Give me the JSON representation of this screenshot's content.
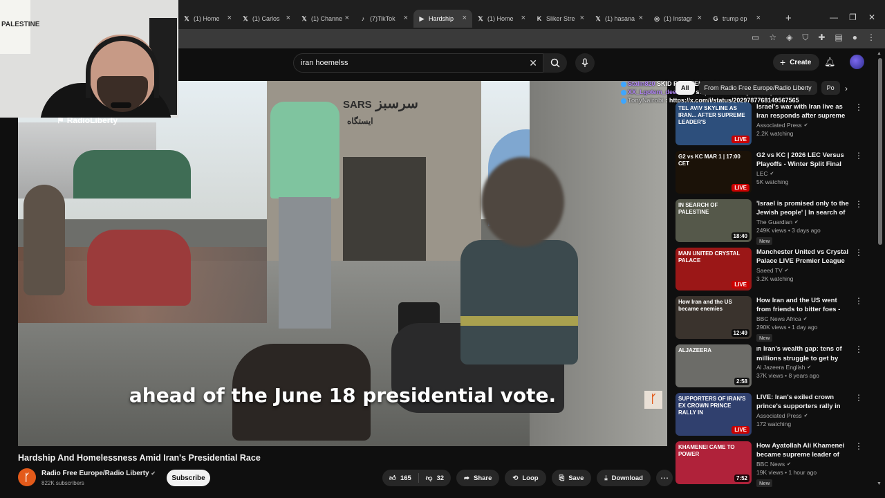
{
  "browser": {
    "tabs": [
      {
        "label": "(1) Home",
        "icon": "x-logo-icon",
        "glyph": "𝕏",
        "active": false
      },
      {
        "label": "(1) Carlos",
        "icon": "x-logo-icon",
        "glyph": "𝕏",
        "active": false
      },
      {
        "label": "(1) Channe",
        "icon": "x-logo-icon",
        "glyph": "𝕏",
        "active": false
      },
      {
        "label": "(7)TikTok",
        "icon": "tiktok-icon",
        "glyph": "♪",
        "active": false
      },
      {
        "label": "Hardship",
        "icon": "youtube-icon",
        "glyph": "▶",
        "active": true
      },
      {
        "label": "(1) Home",
        "icon": "x-logo-icon",
        "glyph": "𝕏",
        "active": false
      },
      {
        "label": "Sliker Stre",
        "icon": "kick-icon",
        "glyph": "K",
        "active": false
      },
      {
        "label": "(1) hasana",
        "icon": "x-logo-icon",
        "glyph": "𝕏",
        "active": false
      },
      {
        "label": "(1) Instagr",
        "icon": "instagram-icon",
        "glyph": "◎",
        "active": false
      },
      {
        "label": "trump ep",
        "icon": "google-icon",
        "glyph": "G",
        "active": false
      }
    ],
    "new_tab_glyph": "+",
    "close_glyph": "×",
    "win_min": "—",
    "win_max": "❐",
    "win_close": "✕"
  },
  "header": {
    "search_value": "iran hoemelss",
    "create_label": "Create"
  },
  "chat": [
    {
      "user": "Stalin820",
      "message": "SKID ROW FENTANYL ADDICTS",
      "color": "purple"
    },
    {
      "user": "XX_Lgotem_deez_Xx",
      "message": ": skip to RP already this topic aint it for u",
      "color": "purple"
    },
    {
      "user": "TonyNairobi",
      "message": ": https://x.com/i/status/2029787768149567565",
      "color": "gray"
    }
  ],
  "chips": {
    "items": [
      "All",
      "From Radio Free Europe/Radio Liberty",
      "Po"
    ],
    "active_index": 0
  },
  "video": {
    "overlay_logo": "RadioLiberty",
    "caption": "ahead of the June 18 presidential vote.",
    "watermark": "ᚴ",
    "sign_text": "سرسبز",
    "sign_prefix": "SARS",
    "sign_station": "ایستگاه",
    "poster_text": "PALESTINE"
  },
  "recommended": [
    {
      "title": "Israel's war with Iran live as Iran responds after supreme ...",
      "channel": "Associated Press",
      "verified": true,
      "meta": "2.2K watching",
      "badge": "LIVE",
      "new": false,
      "thumb_text": "TEL AVIV SKYLINE AS IRAN... AFTER SUPREME LEADER'S",
      "thumb_bg": "#2d4f7c"
    },
    {
      "title": "G2 vs KC | 2026 LEC Versus Playoffs - Winter Split Final",
      "channel": "LEC",
      "verified": true,
      "meta": "5K watching",
      "badge": "LIVE",
      "new": false,
      "thumb_text": "G2 vs KC  MAR 1 | 17:00 CET",
      "thumb_bg": "#1b1208"
    },
    {
      "title": "'Israel is promised only to the Jewish people' | In search of ...",
      "channel": "The Guardian",
      "verified": true,
      "meta": "249K views • 3 days ago",
      "badge": "18:40",
      "new": true,
      "thumb_text": "IN SEARCH OF PALESTINE",
      "thumb_bg": "#55584a"
    },
    {
      "title": "Manchester United vs Crystal Palace LIVE Premier League ...",
      "channel": "Saeed TV",
      "verified": true,
      "meta": "3.2K watching",
      "badge": "LIVE",
      "new": false,
      "thumb_text": "MAN UNITED CRYSTAL PALACE",
      "thumb_bg": "#9b1717"
    },
    {
      "title": "How Iran and the US went from friends to bitter foes - BBC ...",
      "channel": "BBC News Africa",
      "verified": true,
      "meta": "290K views • 1 day ago",
      "badge": "12:49",
      "new": true,
      "thumb_text": "How Iran and the US became enemies",
      "thumb_bg": "#3a332d"
    },
    {
      "title": "Iran's wealth gap: tens of millions struggle to get by",
      "channel": "Al Jazeera English",
      "verified": true,
      "meta": "37K views • 8 years ago",
      "badge": "2:58",
      "new": false,
      "thumb_text": "ALJAZEERA",
      "thumb_bg": "#6c6c68",
      "title_prefix": "IR"
    },
    {
      "title": "LIVE: Iran's exiled crown prince's supporters rally in Germany ...",
      "channel": "Associated Press",
      "verified": true,
      "meta": "172 watching",
      "badge": "LIVE",
      "new": false,
      "thumb_text": "SUPPORTERS OF IRAN'S EX CROWN PRINCE RALLY IN",
      "thumb_bg": "#30406e"
    },
    {
      "title": "How Ayatollah Ali Khamenei became supreme leader of Ira...",
      "channel": "BBC News",
      "verified": true,
      "meta": "19K views • 1 hour ago",
      "badge": "7:52",
      "new": true,
      "thumb_text": "KHAMENEI CAME TO POWER",
      "thumb_bg": "#b0223a"
    }
  ],
  "new_label": "New",
  "below": {
    "title": "Hardship And Homelessness Amid Iran's Presidential Race",
    "channel": "Radio Free Europe/Radio Liberty",
    "subscribers": "822K subscribers",
    "subscribe_label": "Subscribe",
    "likes": "165",
    "dislikes": "32",
    "share_label": "Share",
    "loop_label": "Loop",
    "save_label": "Save",
    "download_label": "Download"
  },
  "colors": {
    "background": "#0f0f0f",
    "youtube_red": "#ff0000",
    "live_red": "#cc0000",
    "rferl_orange": "#e35a1a"
  }
}
